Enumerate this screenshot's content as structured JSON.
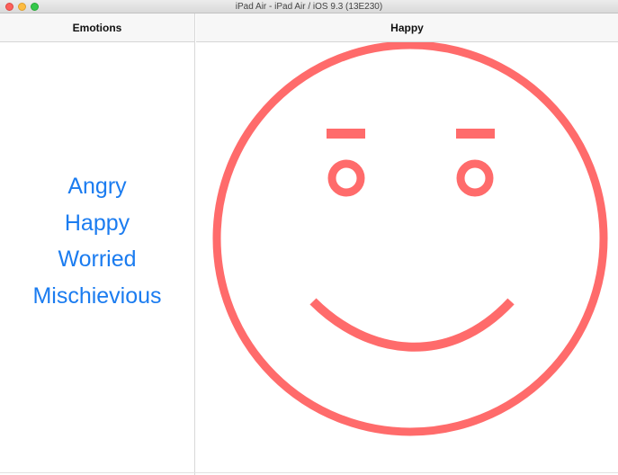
{
  "window": {
    "title": "iPad Air - iPad Air / iOS 9.3 (13E230)"
  },
  "master": {
    "nav_title": "Emotions",
    "items": [
      {
        "label": "Angry"
      },
      {
        "label": "Happy"
      },
      {
        "label": "Worried"
      },
      {
        "label": "Mischievious"
      }
    ]
  },
  "detail": {
    "nav_title": "Happy",
    "face": {
      "expression": "happy",
      "color": "#ff6b6b"
    }
  },
  "colors": {
    "link": "#1b7cf0",
    "face_stroke": "#ff6b6b"
  }
}
